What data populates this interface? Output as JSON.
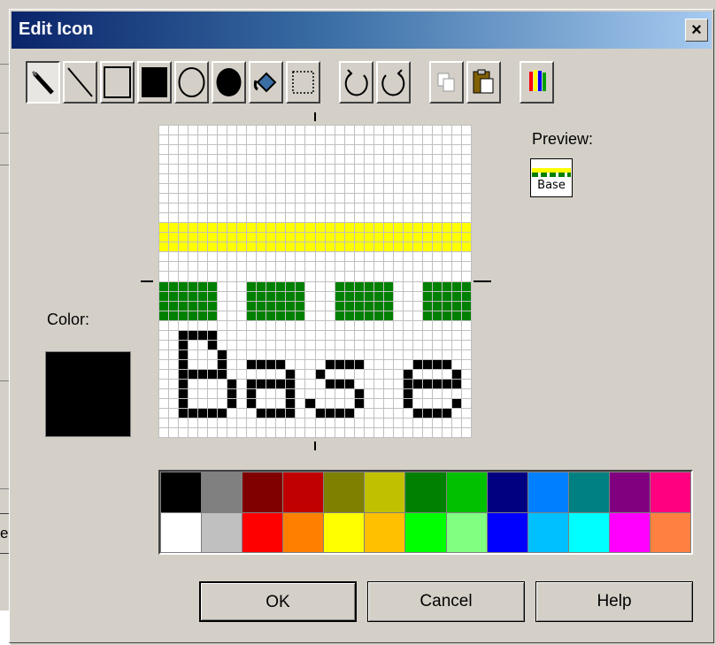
{
  "dialog": {
    "title": "Edit Icon",
    "close_label": "×"
  },
  "background_window": {
    "partial_button_label": "el"
  },
  "toolbar": {
    "tools": [
      {
        "name": "pencil-tool",
        "icon": "pencil-icon",
        "pressed": true
      },
      {
        "name": "line-tool",
        "icon": "line-icon"
      },
      {
        "name": "rectangle-tool",
        "icon": "rectangle-outline-icon"
      },
      {
        "name": "filled-rectangle-tool",
        "icon": "filled-rectangle-icon"
      },
      {
        "name": "ellipse-tool",
        "icon": "ellipse-outline-icon"
      },
      {
        "name": "filled-ellipse-tool",
        "icon": "filled-ellipse-icon"
      },
      {
        "name": "fill-tool",
        "icon": "paint-bucket-icon"
      },
      {
        "name": "select-tool",
        "icon": "dashed-selection-icon"
      },
      {
        "name": "undo-tool",
        "icon": "rotate-left-icon"
      },
      {
        "name": "redo-tool",
        "icon": "rotate-right-icon"
      },
      {
        "name": "copy-tool",
        "icon": "copy-icon"
      },
      {
        "name": "paste-tool",
        "icon": "clipboard-icon"
      },
      {
        "name": "color-picker-tool",
        "icon": "crayons-icon"
      }
    ]
  },
  "preview": {
    "label": "Preview:",
    "text": "Base"
  },
  "color": {
    "label": "Color:",
    "current": "#000000"
  },
  "icon_grid": {
    "size": 32,
    "rows_yellow": [
      10,
      11,
      12
    ],
    "rows_green": [
      16,
      17,
      18,
      19
    ],
    "green_cols": [
      [
        0,
        5
      ],
      [
        9,
        14
      ],
      [
        18,
        23
      ],
      [
        27,
        31
      ]
    ],
    "text": "Base",
    "pixel_colors": {
      "yellow": "#ffff00",
      "green": "#008000",
      "black": "#000000",
      "white": "#ffffff"
    }
  },
  "palette": {
    "colors": [
      "#000000",
      "#808080",
      "#800000",
      "#c00000",
      "#808000",
      "#c0c000",
      "#008000",
      "#00c000",
      "#000080",
      "#0080ff",
      "#008080",
      "#800080",
      "#ff0080",
      "#ffffff",
      "#c0c0c0",
      "#ff0000",
      "#ff8000",
      "#ffff00",
      "#ffc000",
      "#00ff00",
      "#80ff80",
      "#0000ff",
      "#00c0ff",
      "#00ffff",
      "#ff00ff",
      "#ff8040"
    ]
  },
  "buttons": {
    "ok": "OK",
    "cancel": "Cancel",
    "help": "Help"
  }
}
